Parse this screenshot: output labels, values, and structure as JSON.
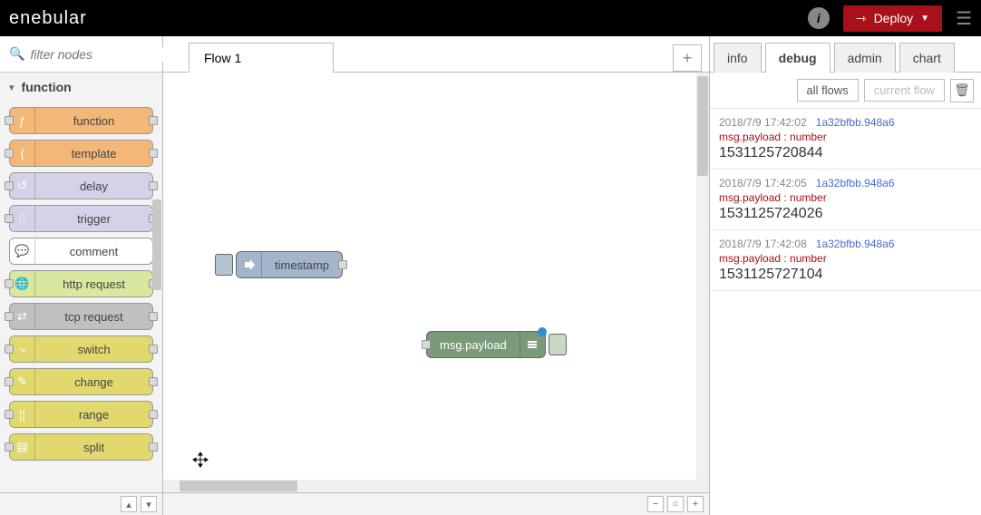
{
  "header": {
    "logo": "enebular",
    "deploy_label": "Deploy"
  },
  "sidebar": {
    "filter_placeholder": "filter nodes",
    "category_label": "function",
    "nodes": [
      {
        "label": "function",
        "bg": "#f3b878",
        "icon": "ƒ",
        "ports": "both"
      },
      {
        "label": "template",
        "bg": "#f3b878",
        "icon": "{",
        "ports": "both"
      },
      {
        "label": "delay",
        "bg": "#d6d0e8",
        "icon": "↺",
        "ports": "both"
      },
      {
        "label": "trigger",
        "bg": "#d6d0e8",
        "icon": "⎍",
        "ports": "both"
      },
      {
        "label": "comment",
        "bg": "#ffffff",
        "icon": "💬",
        "ports": "none"
      },
      {
        "label": "http request",
        "bg": "#d8e89e",
        "icon": "🌐",
        "ports": "both"
      },
      {
        "label": "tcp request",
        "bg": "#c0c0c0",
        "icon": "⇄",
        "ports": "both"
      },
      {
        "label": "switch",
        "bg": "#e2d96e",
        "icon": "⤷",
        "ports": "both"
      },
      {
        "label": "change",
        "bg": "#e2d96e",
        "icon": "✎",
        "ports": "both"
      },
      {
        "label": "range",
        "bg": "#e2d96e",
        "icon": "¦¦",
        "ports": "both"
      },
      {
        "label": "split",
        "bg": "#e2d96e",
        "icon": "▤",
        "ports": "both"
      }
    ]
  },
  "tabs": {
    "flow_tab": "Flow 1"
  },
  "canvas": {
    "inject_node": {
      "label": "timestamp",
      "bg": "#a3b6c9",
      "btn_bg": "#b4c4d3"
    },
    "debug_node": {
      "label": "msg.payload",
      "bg": "#7a9a7a",
      "btn_bg": "#c9d8c5",
      "status": "#2a8fd8"
    }
  },
  "right_panel": {
    "tabs": [
      "info",
      "debug",
      "admin",
      "chart"
    ],
    "active_tab": "debug",
    "filter_all": "all flows",
    "filter_current": "current flow",
    "messages": [
      {
        "time": "2018/7/9 17:42:02",
        "node": "1a32bfbb.948a6",
        "prop": "msg.payload : number",
        "value": "1531125720844"
      },
      {
        "time": "2018/7/9 17:42:05",
        "node": "1a32bfbb.948a6",
        "prop": "msg.payload : number",
        "value": "1531125724026"
      },
      {
        "time": "2018/7/9 17:42:08",
        "node": "1a32bfbb.948a6",
        "prop": "msg.payload : number",
        "value": "1531125727104"
      }
    ]
  }
}
